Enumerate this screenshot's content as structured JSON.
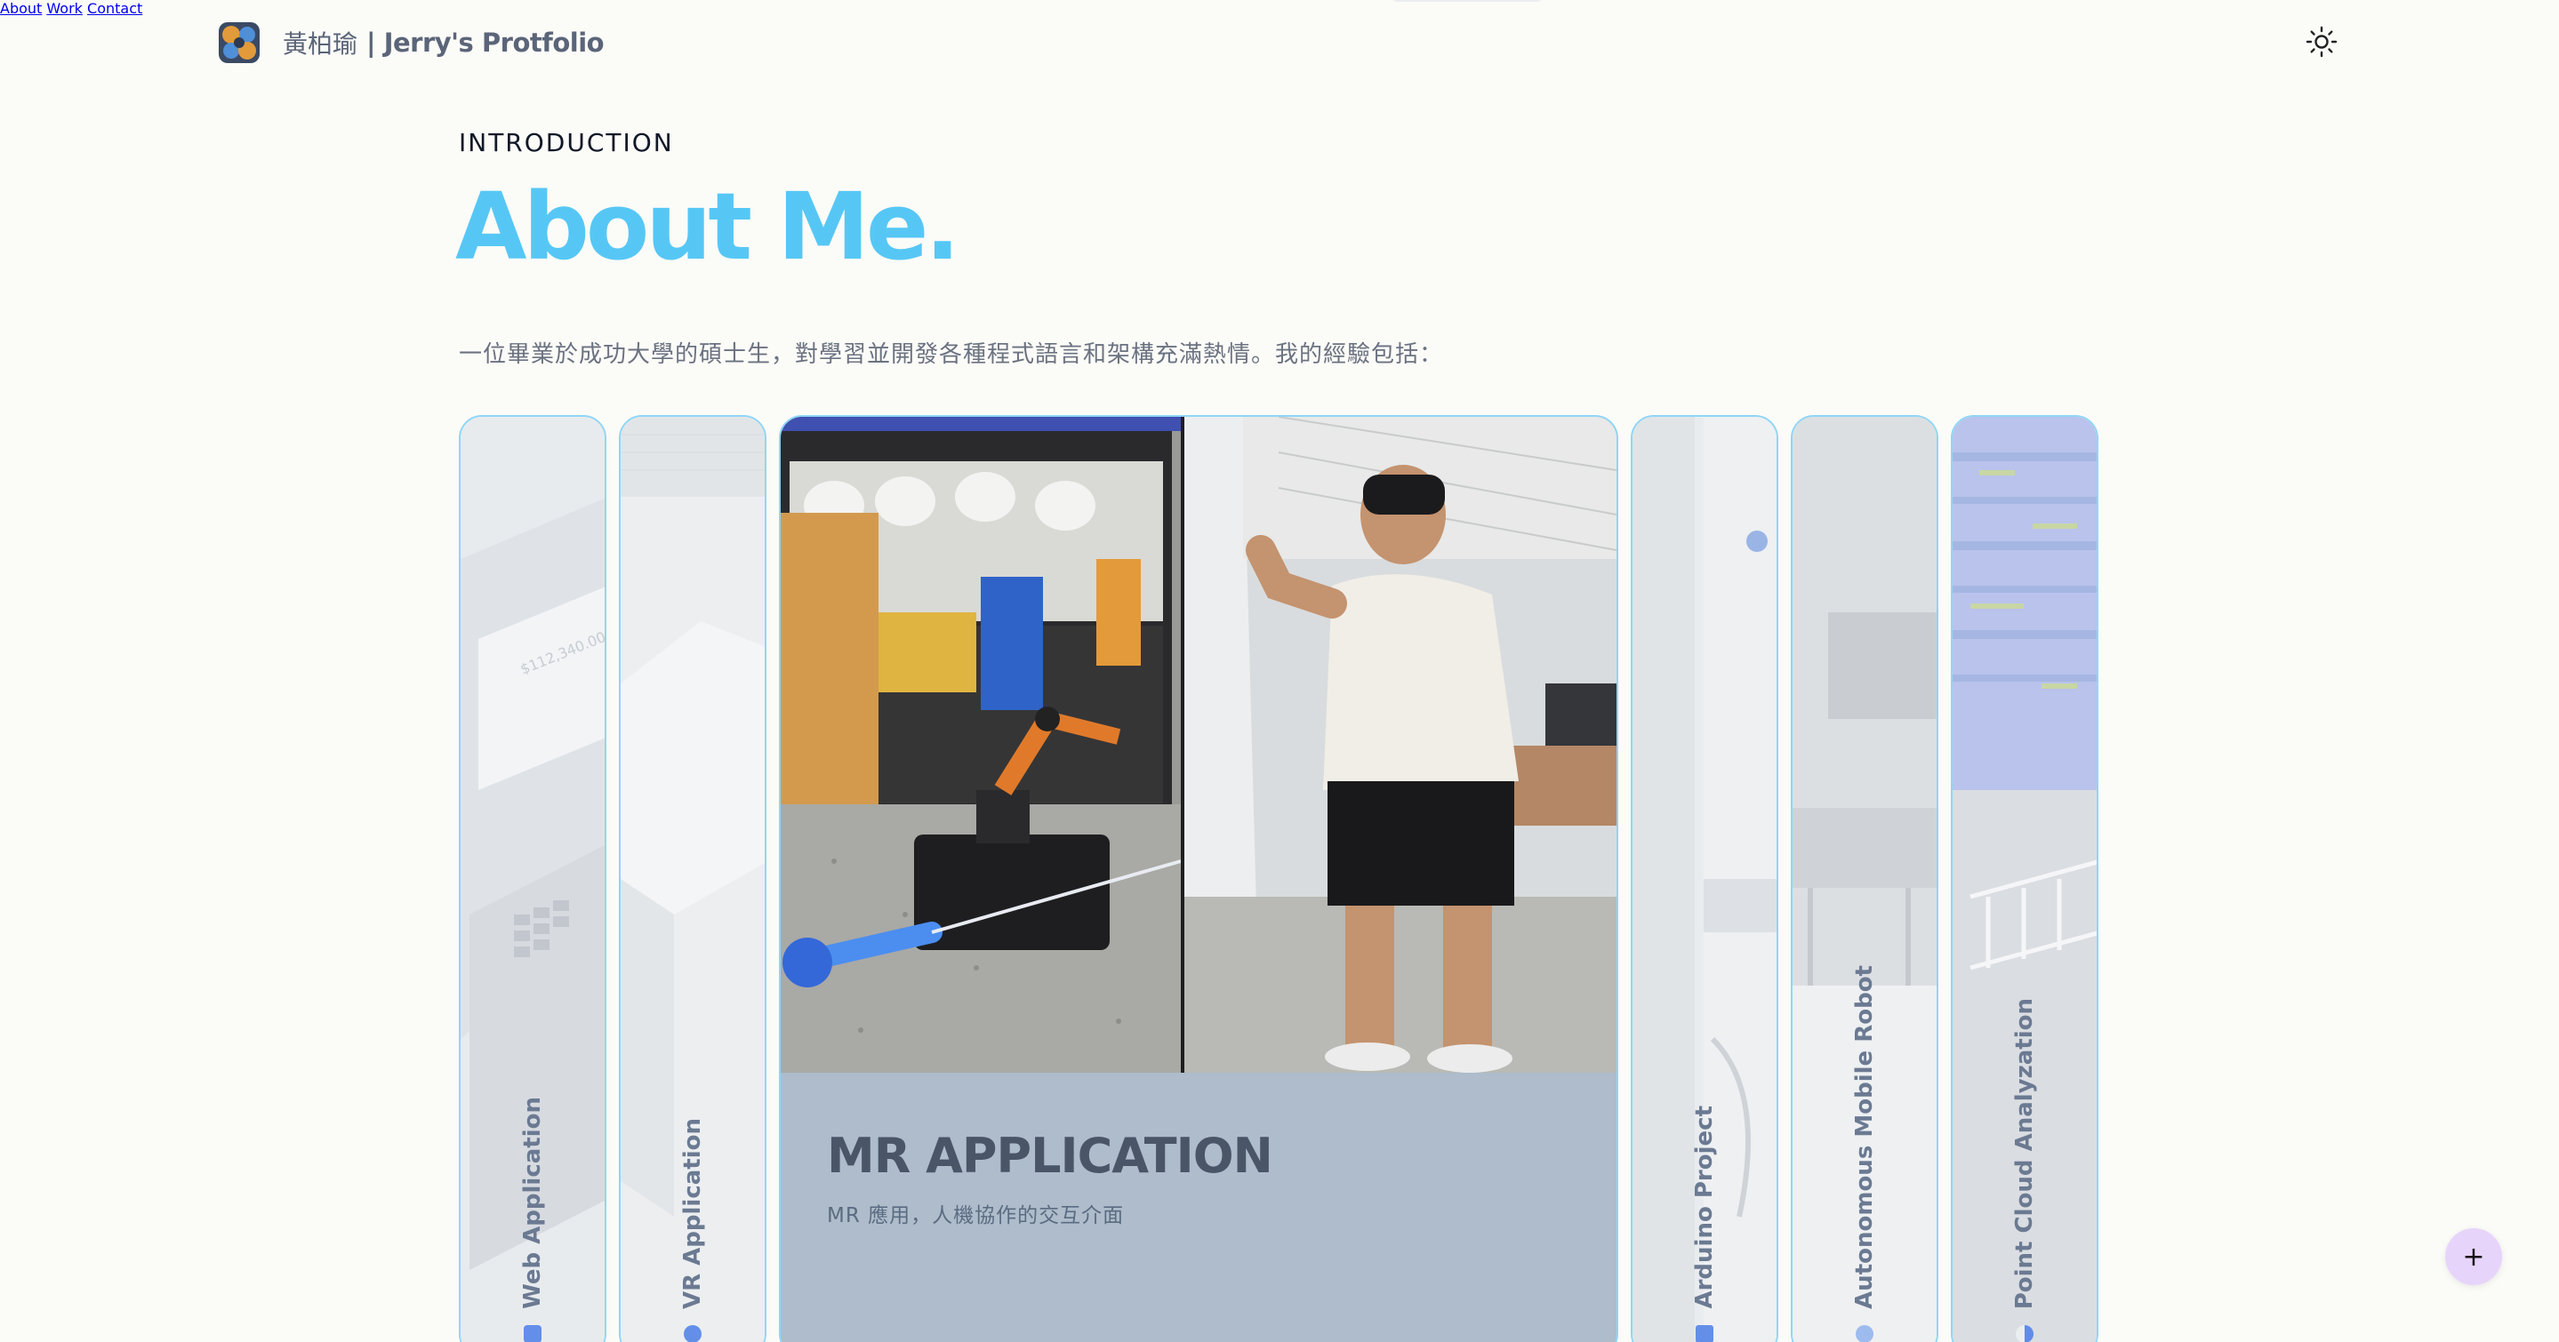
{
  "header": {
    "brand_cn": "黃柏瑜",
    "brand_en": "| Jerry's Protfolio",
    "logo_icon": "swirl-logo",
    "nav": [
      {
        "label": "About"
      },
      {
        "label": "Work"
      },
      {
        "label": "Contact"
      }
    ],
    "theme_icon": "sun-icon"
  },
  "intro": {
    "eyebrow": "INTRODUCTION",
    "title": "About Me.",
    "description": "一位畢業於成功大學的碩士生，對學習並開發各種程式語言和架構充滿熱情。我的經驗包括："
  },
  "cards": [
    {
      "label": "Web Application",
      "icon": "layers-icon"
    },
    {
      "label": "VR Application",
      "icon": "dot-icon"
    },
    {
      "label": "MR APPLICATION",
      "subtitle": "MR 應用，人機協作的交互介面",
      "active": true
    },
    {
      "label": "Arduino Project",
      "icon": "chip-icon"
    },
    {
      "label": "Autonomous Mobile Robot",
      "icon": "gear-icon"
    },
    {
      "label": "Point Cloud Analyzation",
      "icon": "half-circle-icon"
    }
  ],
  "fab": {
    "label": "+"
  },
  "colors": {
    "accent": "#56c7f5",
    "card_border": "#8fd6f6",
    "active_card_bg": "#aebccb",
    "fab_bg": "#e7d4fb"
  }
}
